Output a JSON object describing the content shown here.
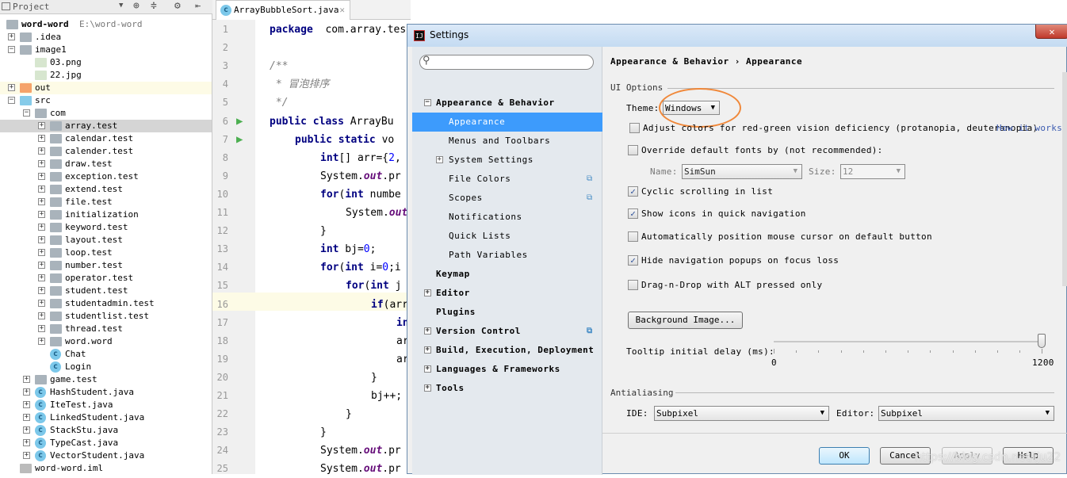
{
  "project_panel": {
    "title": "Project",
    "tree": [
      {
        "label": "word-word",
        "path": "E:\\word-word",
        "level": 0,
        "icon": "module-folder-icon",
        "expander": ""
      },
      {
        "label": ".idea",
        "level": 1,
        "icon": "folder-icon",
        "expander": "+"
      },
      {
        "label": "image1",
        "level": 1,
        "icon": "folder-icon",
        "expander": "-"
      },
      {
        "label": "03.png",
        "level": 2,
        "icon": "image-file-icon",
        "expander": ""
      },
      {
        "label": "22.jpg",
        "level": 2,
        "icon": "image-file-icon",
        "expander": ""
      },
      {
        "label": "out",
        "level": 1,
        "icon": "excluded-folder-icon",
        "expander": "+",
        "state": "highlighted"
      },
      {
        "label": "src",
        "level": 1,
        "icon": "source-folder-icon",
        "expander": "-"
      },
      {
        "label": "com",
        "level": 2,
        "icon": "package-icon",
        "expander": "-"
      },
      {
        "label": "array.test",
        "level": 3,
        "icon": "package-icon",
        "expander": "+",
        "state": "selected"
      },
      {
        "label": "calendar.test",
        "level": 3,
        "icon": "package-icon",
        "expander": "+"
      },
      {
        "label": "calender.test",
        "level": 3,
        "icon": "package-icon",
        "expander": "+"
      },
      {
        "label": "draw.test",
        "level": 3,
        "icon": "package-icon",
        "expander": "+"
      },
      {
        "label": "exception.test",
        "level": 3,
        "icon": "package-icon",
        "expander": "+"
      },
      {
        "label": "extend.test",
        "level": 3,
        "icon": "package-icon",
        "expander": "+"
      },
      {
        "label": "file.test",
        "level": 3,
        "icon": "package-icon",
        "expander": "+"
      },
      {
        "label": "initialization",
        "level": 3,
        "icon": "package-icon",
        "expander": "+"
      },
      {
        "label": "keyword.test",
        "level": 3,
        "icon": "package-icon",
        "expander": "+"
      },
      {
        "label": "layout.test",
        "level": 3,
        "icon": "package-icon",
        "expander": "+"
      },
      {
        "label": "loop.test",
        "level": 3,
        "icon": "package-icon",
        "expander": "+"
      },
      {
        "label": "number.test",
        "level": 3,
        "icon": "package-icon",
        "expander": "+"
      },
      {
        "label": "operator.test",
        "level": 3,
        "icon": "package-icon",
        "expander": "+"
      },
      {
        "label": "student.test",
        "level": 3,
        "icon": "package-icon",
        "expander": "+"
      },
      {
        "label": "studentadmin.test",
        "level": 3,
        "icon": "package-icon",
        "expander": "+"
      },
      {
        "label": "studentlist.test",
        "level": 3,
        "icon": "package-icon",
        "expander": "+"
      },
      {
        "label": "thread.test",
        "level": 3,
        "icon": "package-icon",
        "expander": "+"
      },
      {
        "label": "word.word",
        "level": 3,
        "icon": "package-icon",
        "expander": "+"
      },
      {
        "label": "Chat",
        "level": 3,
        "icon": "java-class-icon",
        "expander": ""
      },
      {
        "label": "Login",
        "level": 3,
        "icon": "java-class-icon",
        "expander": ""
      },
      {
        "label": "game.test",
        "level": 2,
        "icon": "package-icon",
        "expander": "+"
      },
      {
        "label": "HashStudent.java",
        "level": 2,
        "icon": "java-class-icon",
        "expander": "+"
      },
      {
        "label": "IteTest.java",
        "level": 2,
        "icon": "java-class-icon",
        "expander": "+"
      },
      {
        "label": "LinkedStudent.java",
        "level": 2,
        "icon": "java-class-icon",
        "expander": "+"
      },
      {
        "label": "StackStu.java",
        "level": 2,
        "icon": "java-class-icon",
        "expander": "+"
      },
      {
        "label": "TypeCast.java",
        "level": 2,
        "icon": "java-class-icon",
        "expander": "+"
      },
      {
        "label": "VectorStudent.java",
        "level": 2,
        "icon": "java-class-icon",
        "expander": "+"
      },
      {
        "label": "word-word.iml",
        "level": 1,
        "icon": "iml-file-icon",
        "expander": ""
      }
    ]
  },
  "editor": {
    "tab": "ArrayBubbleSort.java",
    "current_line": 16,
    "lines": [
      {
        "n": "1",
        "indent": 0,
        "parts": [
          [
            "kw",
            "package"
          ],
          [
            "",
            "  com.array.tes"
          ]
        ]
      },
      {
        "n": "2",
        "indent": 0,
        "parts": []
      },
      {
        "n": "3",
        "indent": 0,
        "parts": [
          [
            "cm",
            "/**"
          ]
        ]
      },
      {
        "n": "4",
        "indent": 0,
        "parts": [
          [
            "cm",
            " * 冒泡排序"
          ]
        ]
      },
      {
        "n": "5",
        "indent": 0,
        "parts": [
          [
            "cm",
            " */"
          ]
        ]
      },
      {
        "n": "6",
        "indent": 0,
        "parts": [
          [
            "kw",
            "public class"
          ],
          [
            "",
            " ArrayBu"
          ]
        ],
        "run": true
      },
      {
        "n": "7",
        "indent": 1,
        "parts": [
          [
            "kw",
            "public static"
          ],
          [
            "",
            " vo"
          ]
        ],
        "run": true
      },
      {
        "n": "8",
        "indent": 2,
        "parts": [
          [
            "kw",
            "int"
          ],
          [
            "",
            "[] arr={"
          ],
          [
            "nm",
            "2"
          ],
          [
            "",
            ","
          ]
        ]
      },
      {
        "n": "9",
        "indent": 2,
        "parts": [
          [
            "",
            "System."
          ],
          [
            "st",
            "out"
          ],
          [
            "",
            ".pr"
          ]
        ]
      },
      {
        "n": "10",
        "indent": 2,
        "parts": [
          [
            "kw",
            "for"
          ],
          [
            "",
            "("
          ],
          [
            "kw",
            "int"
          ],
          [
            "",
            " numbe"
          ]
        ]
      },
      {
        "n": "11",
        "indent": 3,
        "parts": [
          [
            "",
            "System."
          ],
          [
            "st",
            "out"
          ]
        ]
      },
      {
        "n": "12",
        "indent": 2,
        "parts": [
          [
            "",
            "}"
          ]
        ]
      },
      {
        "n": "13",
        "indent": 2,
        "parts": [
          [
            "kw",
            "int"
          ],
          [
            "",
            " bj="
          ],
          [
            "nm",
            "0"
          ],
          [
            "",
            ";"
          ]
        ]
      },
      {
        "n": "14",
        "indent": 2,
        "parts": [
          [
            "kw",
            "for"
          ],
          [
            "",
            "("
          ],
          [
            "kw",
            "int"
          ],
          [
            "",
            " i="
          ],
          [
            "nm",
            "0"
          ],
          [
            "",
            ";i"
          ]
        ]
      },
      {
        "n": "15",
        "indent": 3,
        "parts": [
          [
            "kw",
            "for"
          ],
          [
            "",
            "("
          ],
          [
            "kw",
            "int"
          ],
          [
            "",
            " j"
          ]
        ]
      },
      {
        "n": "16",
        "indent": 4,
        "parts": [
          [
            "kw",
            "if"
          ],
          [
            "",
            "(arr"
          ]
        ]
      },
      {
        "n": "17",
        "indent": 5,
        "parts": [
          [
            "kw",
            "in"
          ]
        ]
      },
      {
        "n": "18",
        "indent": 5,
        "parts": [
          [
            "",
            "ar"
          ]
        ]
      },
      {
        "n": "19",
        "indent": 5,
        "parts": [
          [
            "",
            "ar"
          ]
        ]
      },
      {
        "n": "20",
        "indent": 4,
        "parts": [
          [
            "",
            "}"
          ]
        ]
      },
      {
        "n": "21",
        "indent": 4,
        "parts": [
          [
            "",
            "bj++;"
          ]
        ]
      },
      {
        "n": "22",
        "indent": 3,
        "parts": [
          [
            "",
            "}"
          ]
        ]
      },
      {
        "n": "23",
        "indent": 2,
        "parts": [
          [
            "",
            "}"
          ]
        ]
      },
      {
        "n": "24",
        "indent": 2,
        "parts": [
          [
            "",
            "System."
          ],
          [
            "st",
            "out"
          ],
          [
            "",
            ".pr"
          ]
        ]
      },
      {
        "n": "25",
        "indent": 2,
        "parts": [
          [
            "",
            "System."
          ],
          [
            "st",
            "out"
          ],
          [
            "",
            ".pr"
          ]
        ]
      }
    ]
  },
  "settings": {
    "title": "Settings",
    "search_placeholder": "",
    "nav": [
      {
        "label": "Appearance & Behavior",
        "bold": true,
        "level": 0,
        "expander": "-"
      },
      {
        "label": "Appearance",
        "level": 1,
        "selected": true
      },
      {
        "label": "Menus and Toolbars",
        "level": 1
      },
      {
        "label": "System Settings",
        "level": 1,
        "expander": "+"
      },
      {
        "label": "File Colors",
        "level": 1,
        "project_icon": true
      },
      {
        "label": "Scopes",
        "level": 1,
        "project_icon": true
      },
      {
        "label": "Notifications",
        "level": 1
      },
      {
        "label": "Quick Lists",
        "level": 1
      },
      {
        "label": "Path Variables",
        "level": 1
      },
      {
        "label": "Keymap",
        "bold": true,
        "level": 0
      },
      {
        "label": "Editor",
        "bold": true,
        "level": 0,
        "expander": "+"
      },
      {
        "label": "Plugins",
        "bold": true,
        "level": 0
      },
      {
        "label": "Version Control",
        "bold": true,
        "level": 0,
        "expander": "+",
        "project_icon": true
      },
      {
        "label": "Build, Execution, Deployment",
        "bold": true,
        "level": 0,
        "expander": "+"
      },
      {
        "label": "Languages & Frameworks",
        "bold": true,
        "level": 0,
        "expander": "+"
      },
      {
        "label": "Tools",
        "bold": true,
        "level": 0,
        "expander": "+"
      }
    ],
    "breadcrumb": {
      "parent": "Appearance & Behavior",
      "sep": "›",
      "current": "Appearance"
    },
    "ui_options": {
      "section": "UI Options",
      "theme_label": "Theme:",
      "theme_value": "Windows",
      "options": [
        {
          "label": "Adjust colors for red-green vision deficiency (protanopia, deuteranopia)",
          "checked": false,
          "link": "How it works"
        },
        {
          "label": "Override default fonts by (not recommended):",
          "checked": false
        },
        {
          "label": "Cyclic scrolling in list",
          "checked": true
        },
        {
          "label": "Show icons in quick navigation",
          "checked": true
        },
        {
          "label": "Automatically position mouse cursor on default button",
          "checked": false
        },
        {
          "label": "Hide navigation popups on focus loss",
          "checked": true
        },
        {
          "label": "Drag-n-Drop with ALT pressed only",
          "checked": false
        }
      ],
      "font_name_label": "Name:",
      "font_name": "SimSun",
      "font_size_label": "Size:",
      "font_size": "12",
      "background_image_button": "Background Image...",
      "tooltip_label": "Tooltip initial delay (ms):",
      "tooltip_min": "0",
      "tooltip_max": "1200",
      "tooltip_value": 1200
    },
    "antialiasing": {
      "section": "Antialiasing",
      "ide_label": "IDE:",
      "ide_value": "Subpixel",
      "editor_label": "Editor:",
      "editor_value": "Subpixel"
    },
    "buttons": {
      "ok": "OK",
      "cancel": "Cancel",
      "apply": "Apply",
      "help": "Help"
    },
    "watermark": "https://blog.csdn.net/iju22",
    "highlight_color": "#f0883a",
    "accent_color": "#3d9bfc"
  }
}
